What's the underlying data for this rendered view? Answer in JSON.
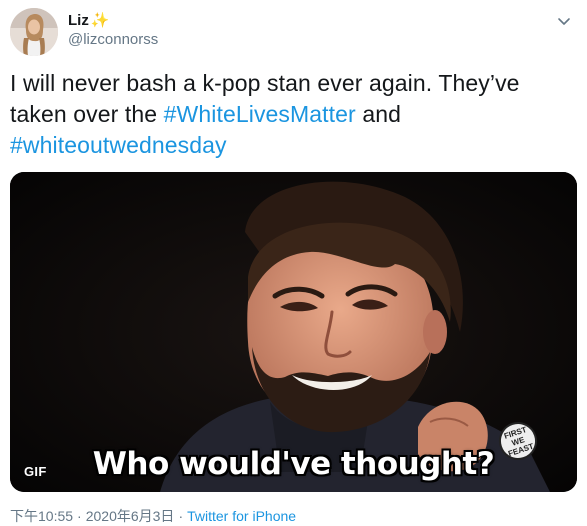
{
  "user": {
    "display_name": "Liz",
    "name_emoji": "✨",
    "handle": "@lizconnorss",
    "avatar_icon": "profile-photo"
  },
  "tweet": {
    "text_before": "I will never bash a k-pop stan ever again. They’ve taken over the ",
    "hashtag_1": "#WhiteLivesMatter",
    "text_middle": " and ",
    "hashtag_2": "#whiteoutwednesday"
  },
  "media": {
    "gif_badge": "GIF",
    "caption": "Who would've thought?",
    "watermark": "FIRST WE FEAST"
  },
  "meta": {
    "time": "下午10:55",
    "separator": "·",
    "date": "2020年6月3日",
    "source": "Twitter for iPhone"
  },
  "colors": {
    "link": "#1b95e0",
    "secondary_text": "#657786",
    "primary_text": "#14171a"
  }
}
